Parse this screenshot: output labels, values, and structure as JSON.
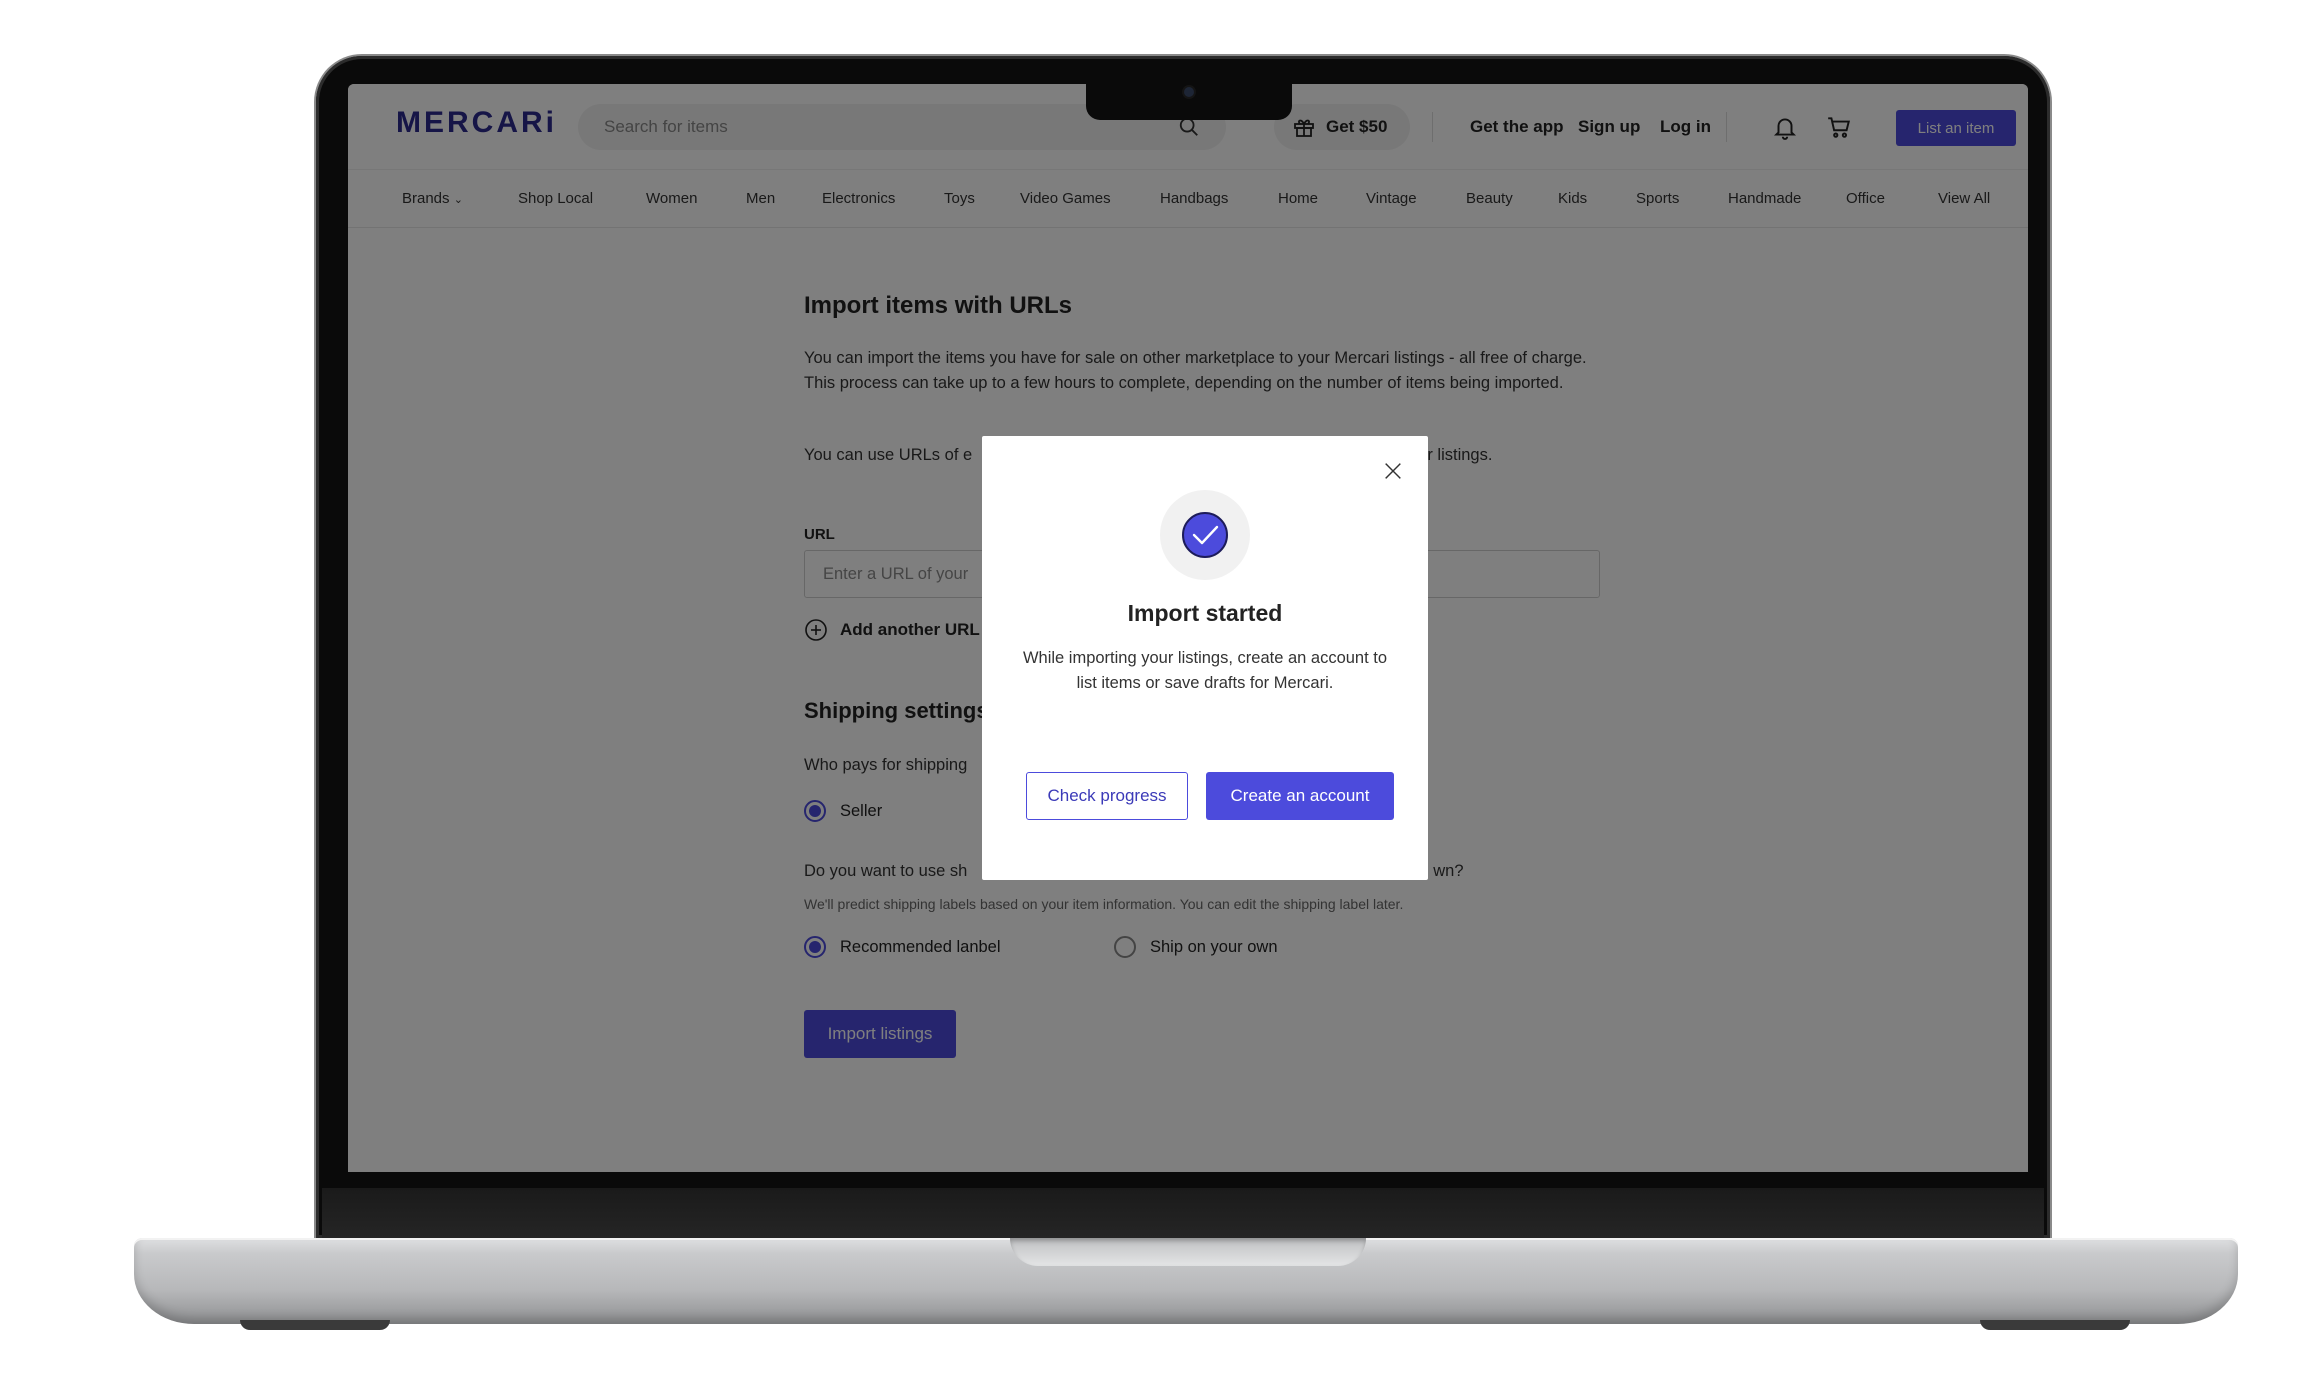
{
  "colors": {
    "accent": "#4c4bdc",
    "logo": "#2c2b8f",
    "overlay": "rgba(0,0,0,0.5)"
  },
  "header": {
    "logo": "MERCARi",
    "search": {
      "placeholder": "Search for items",
      "value": "",
      "icon": "search-icon"
    },
    "promo_label": "Get $50",
    "promo_icon": "gift-icon",
    "get_app": "Get the app",
    "sign_up": "Sign up",
    "log_in": "Log in",
    "notifications_icon": "bell-icon",
    "cart_icon": "cart-icon",
    "list_item": "List an item"
  },
  "categories": [
    "Brands",
    "Shop Local",
    "Women",
    "Men",
    "Electronics",
    "Toys",
    "Video Games",
    "Handbags",
    "Home",
    "Vintage",
    "Beauty",
    "Kids",
    "Sports",
    "Handmade",
    "Office",
    "View All"
  ],
  "page": {
    "title": "Import items with URLs",
    "intro": "You can import the items you have for sale on other marketplace to your Mercari listings - all free of charge. This process can take up to a few hours to complete, depending on the number of items being imported.",
    "note_start": "You can use URLs of e",
    "note_end": "ur listings.",
    "url_label": "URL",
    "url_placeholder": "Enter a URL of your",
    "add_url": "Add another URL",
    "shipping_title": "Shipping settings",
    "who_pays": "Who pays for shipping",
    "seller": "Seller",
    "q2_start": "Do you want to use sh",
    "q2_end": "wn?",
    "q2_sub": "We'll predict shipping labels based on your item information. You can edit the shipping label later.",
    "opt_recommended": "Recommended lanbel",
    "opt_own": "Ship on your own",
    "import_button": "Import listings"
  },
  "modal": {
    "title": "Import started",
    "body": "While importing your listings, create an account to list items or save drafts for Mercari.",
    "check_progress": "Check progress",
    "create_account": "Create an account",
    "close_icon": "close-icon",
    "status_icon": "check-circle-icon"
  }
}
